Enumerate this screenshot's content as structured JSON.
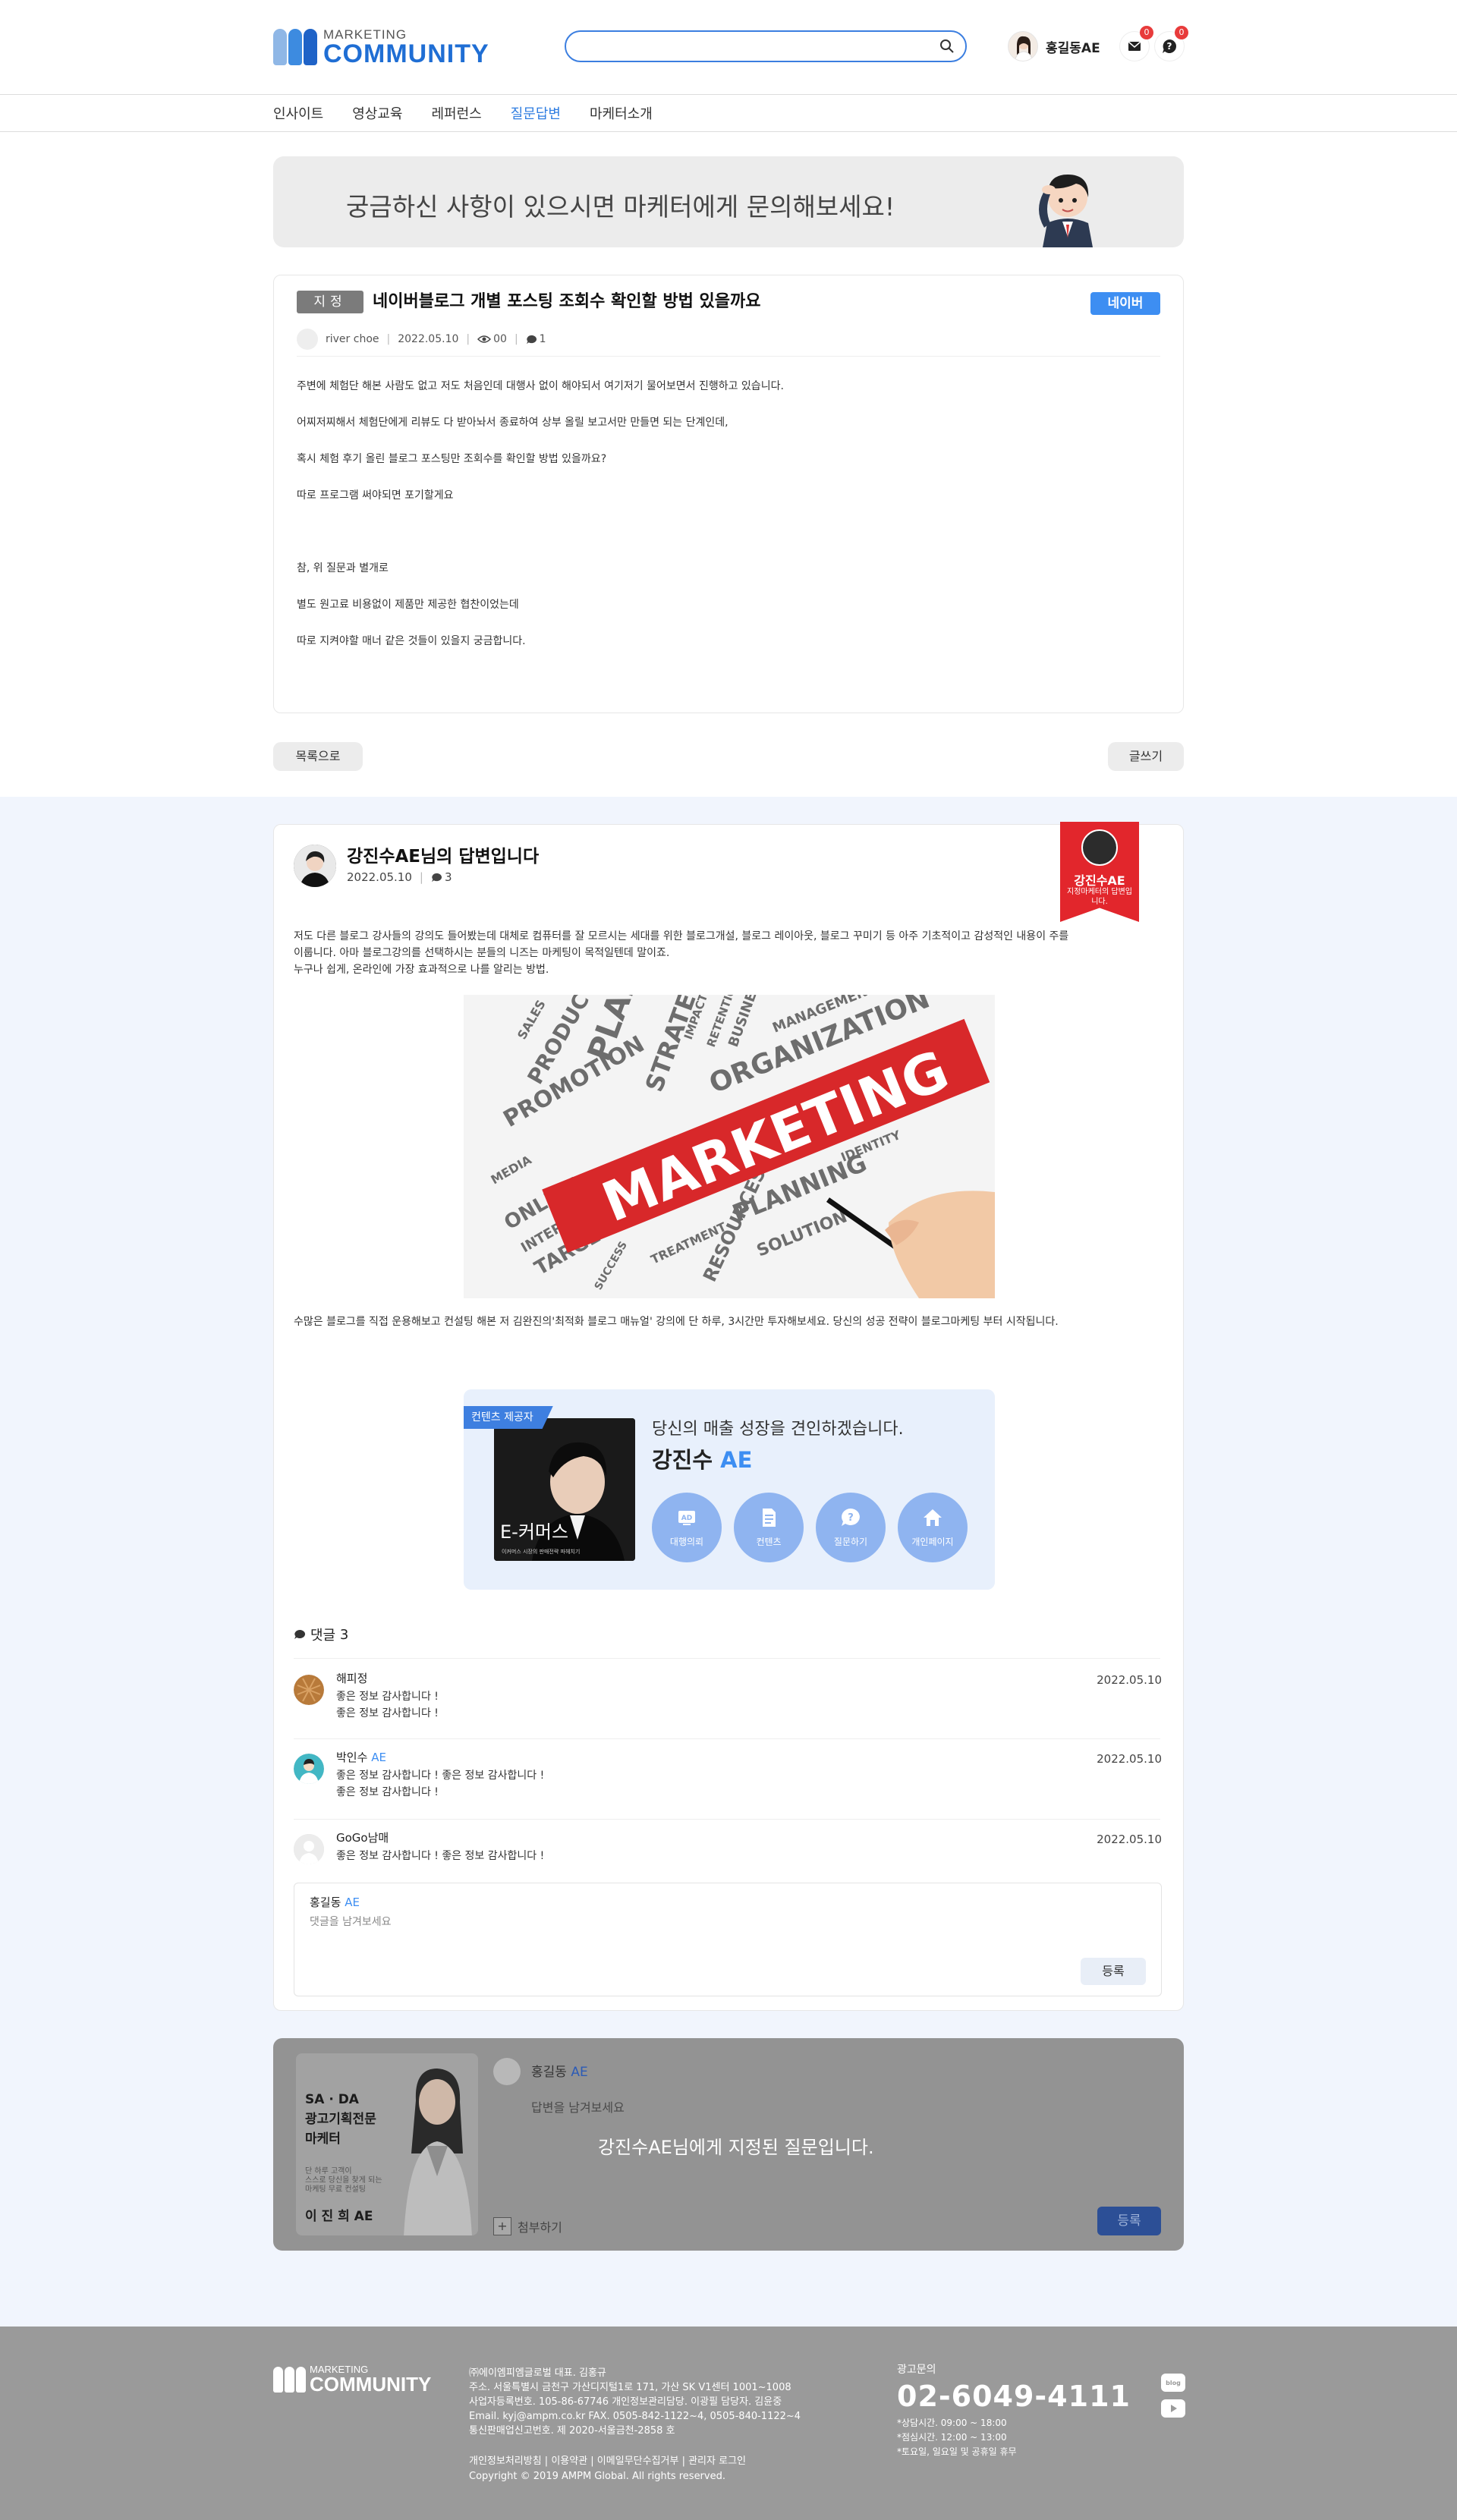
{
  "header": {
    "logo_small": "MARKETING",
    "logo_big": "COMMUNITY",
    "search_placeholder": "",
    "user_name": "홍길동AE",
    "mail_badge": "0",
    "qna_badge": "0"
  },
  "nav": [
    "인사이트",
    "영상교육",
    "레퍼런스",
    "질문답변",
    "마케터소개"
  ],
  "nav_active_index": 3,
  "banner": {
    "text": "궁금하신 사항이 있으시면 마케터에게 문의해보세요!"
  },
  "question": {
    "badge": "지정",
    "title": "네이버블로그 개별 포스팅 조회수 확인할 방법 있을까요",
    "tag": "네이버",
    "author": "river choe",
    "date": "2022.05.10",
    "views": "00",
    "comments": "1",
    "body": [
      "주변에 체험단 해본 사람도 없고 저도 처음인데 대행사 없이 해야되서 여기저기 물어보면서 진행하고 있습니다.",
      "어찌저찌해서 체험단에게 리뷰도 다 받아놔서 종료하여 상부 올릴 보고서만 만들면 되는 단계인데,",
      "혹시 체험 후기 올린 블로그 포스팅만 조회수를 확인할 방법 있을까요?",
      "따로 프로그램 써야되면 포기할게요",
      "",
      "참, 위 질문과 별개로",
      "별도 원고료 비용없이 제품만 제공한 협찬이었는데",
      "따로 지켜야할 매너 같은 것들이 있을지 궁금합니다."
    ]
  },
  "buttons": {
    "list": "목록으로",
    "write": "글쓰기"
  },
  "answer": {
    "title": "강진수AE님의 답변입니다",
    "date": "2022.05.10",
    "comments": "3",
    "ribbon_name": "강진수AE",
    "ribbon_sub": "지정마케터의 답변입니다.",
    "body_lines": [
      "저도 다른 블로그 강사들의 강의도 들어봤는데 대체로 컴퓨터를 잘 모르시는 세대를 위한 블로그개설, 블로그 레이아웃, 블로그 꾸미기 등 아주 기초적이고 감성적인 내용이 주를",
      "이룹니다. 아마 블로그강의를 선택하시는 분들의 니즈는 마케팅이 목적일텐데 말이죠.",
      "누구나 쉽게, 온라인에 가장 효과적으로 나를 알리는 방법."
    ],
    "image_words": {
      "main": "MARKETING",
      "w1": "PLAN",
      "w2": "STRATEGY",
      "w3": "ORGANIZATION",
      "w4": "PROMOTION",
      "w5": "PRODUCT",
      "w6": "ONLINE",
      "w7": "TARGET",
      "w8": "PLANNING",
      "w9": "SOLUTION",
      "w10": "RESOURCES",
      "w11": "MANAGEMENT",
      "w12": "BUSINESS",
      "w13": "SALES",
      "w14": "IDENTITY",
      "w15": "MEDIA",
      "w16": "TREATMENT",
      "w17": "IMPACT",
      "w18": "RETENTION",
      "w19": "INTERNET",
      "w20": "SUCCESS"
    },
    "body2": "수많은 블로그를 직접 운용해보고 컨설팅 해본 저 김완진의'최적화 블로그 매뉴얼' 강의에 단 하루, 3시간만 투자해보세요. 당신의 성공 전략이 블로그마케팅 부터 시작됩니다."
  },
  "profile_card": {
    "tag": "컨텐츠 제공자",
    "photo_caption": "E-커머스",
    "photo_sub": "이커머스 시장의 판매전략 파헤치기",
    "slogan": "당신의 매출 성장을 견인하겠습니다.",
    "name": "강진수",
    "name_suffix": "AE",
    "buttons": [
      "대행의뢰",
      "컨텐츠",
      "질문하기",
      "개인페이지"
    ]
  },
  "comments": {
    "header": "댓글",
    "count": "3",
    "items": [
      {
        "name": "해피정",
        "ae": "",
        "lines": [
          "좋은 정보 감사합니다 !",
          "좋은 정보 감사합니다 !"
        ],
        "date": "2022.05.10"
      },
      {
        "name": "박인수",
        "ae": "AE",
        "lines": [
          "좋은 정보 감사합니다 ! 좋은 정보 감사합니다 !",
          "좋은 정보 감사합니다 !"
        ],
        "date": "2022.05.10"
      },
      {
        "name": "GoGo남매",
        "ae": "",
        "lines": [
          "좋은 정보 감사합니다 ! 좋은 정보 감사합니다 !",
          ""
        ],
        "date": "2022.05.10"
      }
    ],
    "write": {
      "name": "홍길동",
      "ae": "AE",
      "placeholder": "댓글을 남겨보세요",
      "submit": "등록"
    }
  },
  "locked_box": {
    "promo_title": [
      "SA · DA",
      "광고기획전문",
      "마케터"
    ],
    "promo_small": [
      "단 하루 고객이",
      "스스로 당신을 찾게 되는",
      "마케팅 무료 컨설팅"
    ],
    "promo_name": "이 진 희 AE",
    "name": "홍길동",
    "ae": "AE",
    "placeholder": "답변을 남겨보세요",
    "message": "강진수AE님에게 지정된 질문입니다.",
    "attach": "첨부하기",
    "submit": "등록"
  },
  "footer": {
    "logo_small": "MARKETING",
    "logo_big": "COMMUNITY",
    "info": [
      "㈜에이엠피엠글로벌 대표. 김홍규",
      "주소. 서울특별시 금천구 가산디지털1로 171, 가산 SK V1센터 1001~1008",
      "사업자등록번호. 105-86-67746 개인정보관리담당. 이광필 담당자. 김윤중",
      "Email. kyj@ampm.co.kr  FAX. 0505-842-1122~4, 0505-840-1122~4",
      "통신판매업신고번호. 제 2020-서울금천-2858 호"
    ],
    "links": "개인정보처리방침 | 이용약관 | 이메일무단수집거부 | 관리자 로그인",
    "copyright": "Copyright © 2019 AMPM Global. All rights reserved.",
    "call_label": "광고문의",
    "tel": "02-6049-4111",
    "hours": [
      "*상담시간. 09:00 ~ 18:00",
      "*점심시간. 12:00 ~ 13:00",
      "*토요일, 일요일 및 공휴일 휴무"
    ],
    "sns": [
      "blog",
      "youtube"
    ]
  },
  "colors": {
    "accent": "#2f7de1",
    "tag_blue": "#3d8ef2",
    "ribbon_red": "#e2262c",
    "answer_bg": "#f1f5fd",
    "footer_bg": "#9a9a9a"
  }
}
